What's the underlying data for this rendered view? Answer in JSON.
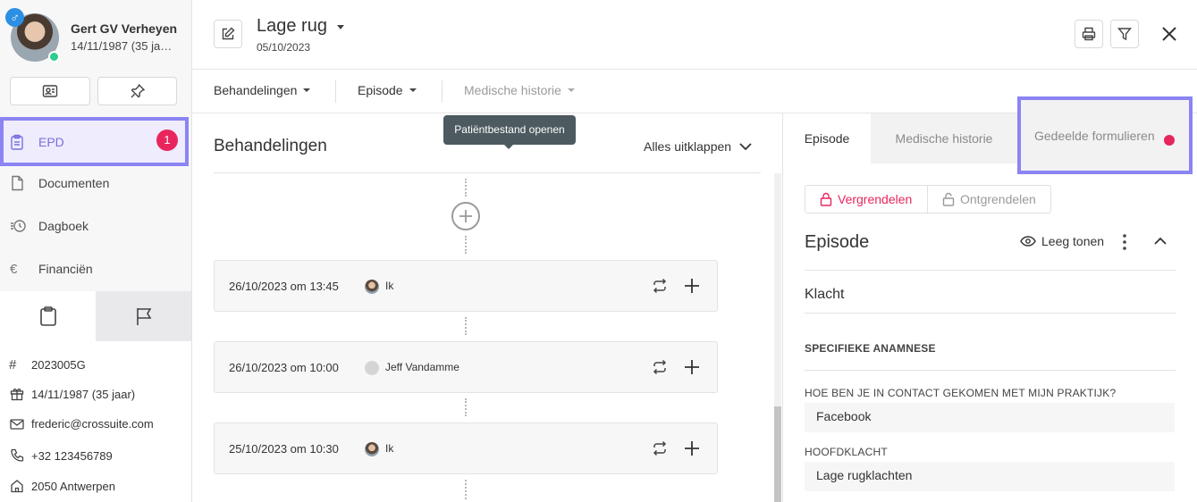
{
  "patient": {
    "name": "Gert GV Verheyen",
    "dob_short": "14/11/1987 (35 ja…",
    "gender_symbol": "♂",
    "status_color": "#2ecc8f"
  },
  "sidebar": {
    "buttons": [
      {
        "icon": "id-card-icon"
      },
      {
        "icon": "pin-icon"
      }
    ],
    "nav": [
      {
        "label": "EPD",
        "icon": "clipboard-icon",
        "badge": "1",
        "active": true
      },
      {
        "label": "Documenten",
        "icon": "document-icon"
      },
      {
        "label": "Dagboek",
        "icon": "history-icon"
      },
      {
        "label": "Financiën",
        "icon": "euro-icon"
      }
    ],
    "tabs": [
      {
        "icon": "clipboard-icon",
        "active": true
      },
      {
        "icon": "flag-icon",
        "active": false
      }
    ],
    "info": [
      {
        "icon": "hash-icon",
        "text": "2023005G"
      },
      {
        "icon": "gift-icon",
        "text": "14/11/1987 (35 jaar)"
      },
      {
        "icon": "mail-icon",
        "text": "frederic@crossuite.com"
      },
      {
        "icon": "phone-icon",
        "text": "+32 123456789"
      },
      {
        "icon": "home-icon",
        "text": "2050 Antwerpen"
      }
    ]
  },
  "header": {
    "title": "Lage rug",
    "date": "05/10/2023",
    "actions": [
      "print-icon",
      "filter-icon",
      "close-icon"
    ]
  },
  "filters": [
    {
      "label": "Behandelingen",
      "muted": false
    },
    {
      "label": "Episode",
      "muted": false
    },
    {
      "label": "Medische historie",
      "muted": true
    }
  ],
  "main": {
    "section_title": "Behandelingen",
    "expand_label": "Alles uitklappen",
    "tooltip": "Patiëntbestand openen",
    "treatments": [
      {
        "datetime": "26/10/2023 om 13:45",
        "by": "Ik"
      },
      {
        "datetime": "26/10/2023 om 10:00",
        "by": "Jeff Vandamme"
      },
      {
        "datetime": "25/10/2023 om 10:30",
        "by": "Ik"
      }
    ]
  },
  "right": {
    "tabs": [
      {
        "label": "Episode",
        "active": true
      },
      {
        "label": "Medische historie",
        "active": false
      },
      {
        "label": "Gedeelde formulieren",
        "active": false,
        "dot_color": "#e8265d"
      }
    ],
    "lock_label": "Vergrendelen",
    "unlock_label": "Ontgrendelen",
    "episode_title": "Episode",
    "show_empty_label": "Leeg tonen",
    "klacht_label": "Klacht",
    "section_label": "SPECIFIEKE ANAMNESE",
    "fields": [
      {
        "question": "HOE BEN JE IN CONTACT GEKOMEN MET MIJN PRAKTIJK?",
        "answer": "Facebook"
      },
      {
        "question": "HOOFDKLACHT",
        "answer": "Lage rugklachten"
      }
    ]
  },
  "colors": {
    "accent": "#8b84f3",
    "badge": "#e8265d",
    "tooltip_bg": "#4d5a60"
  }
}
